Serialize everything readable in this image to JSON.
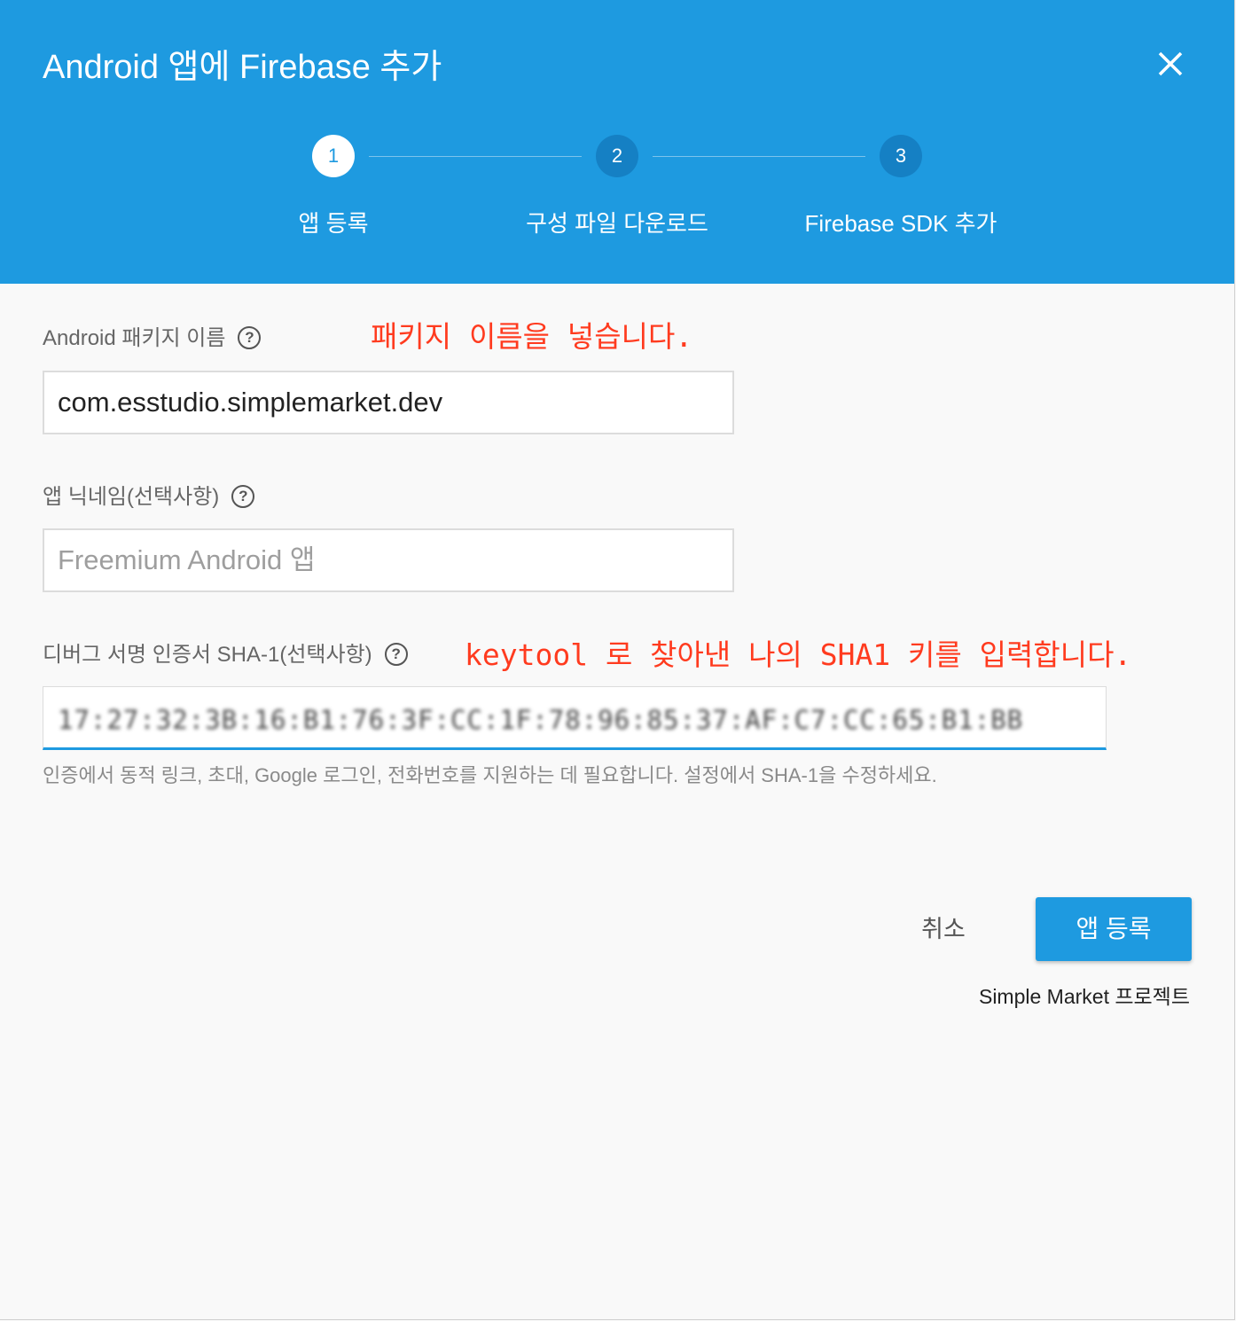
{
  "dialog": {
    "title": "Android 앱에 Firebase 추가",
    "close_icon": "close-icon",
    "accent_color": "#1e9ae0"
  },
  "stepper": {
    "steps": [
      {
        "number": "1",
        "label": "앱 등록",
        "active": true
      },
      {
        "number": "2",
        "label": "구성 파일 다운로드",
        "active": false
      },
      {
        "number": "3",
        "label": "Firebase SDK 추가",
        "active": false
      }
    ]
  },
  "form": {
    "package": {
      "label": "Android 패키지 이름",
      "value": "com.esstudio.simplemarket.dev",
      "annotation": "패키지 이름을 넣습니다."
    },
    "nickname": {
      "label": "앱 닉네임(선택사항)",
      "placeholder": "Freemium Android 앱"
    },
    "sha": {
      "label": "디버그 서명 인증서 SHA-1(선택사항)",
      "value": "17:27:32:3B:16:B1:76:3F:CC:1F:78:96:85:37:AF:C7:CC:65:B1:BB",
      "annotation": "keytool 로 찾아낸 나의 SHA1 키를 입력합니다.",
      "hint": "인증에서 동적 링크, 초대, Google 로그인, 전화번호를 지원하는 데 필요합니다. 설정에서 SHA-1을 수정하세요."
    },
    "help_icon_text": "?"
  },
  "footer": {
    "cancel_label": "취소",
    "register_label": "앱 등록",
    "project_label": "Simple Market 프로젝트"
  }
}
